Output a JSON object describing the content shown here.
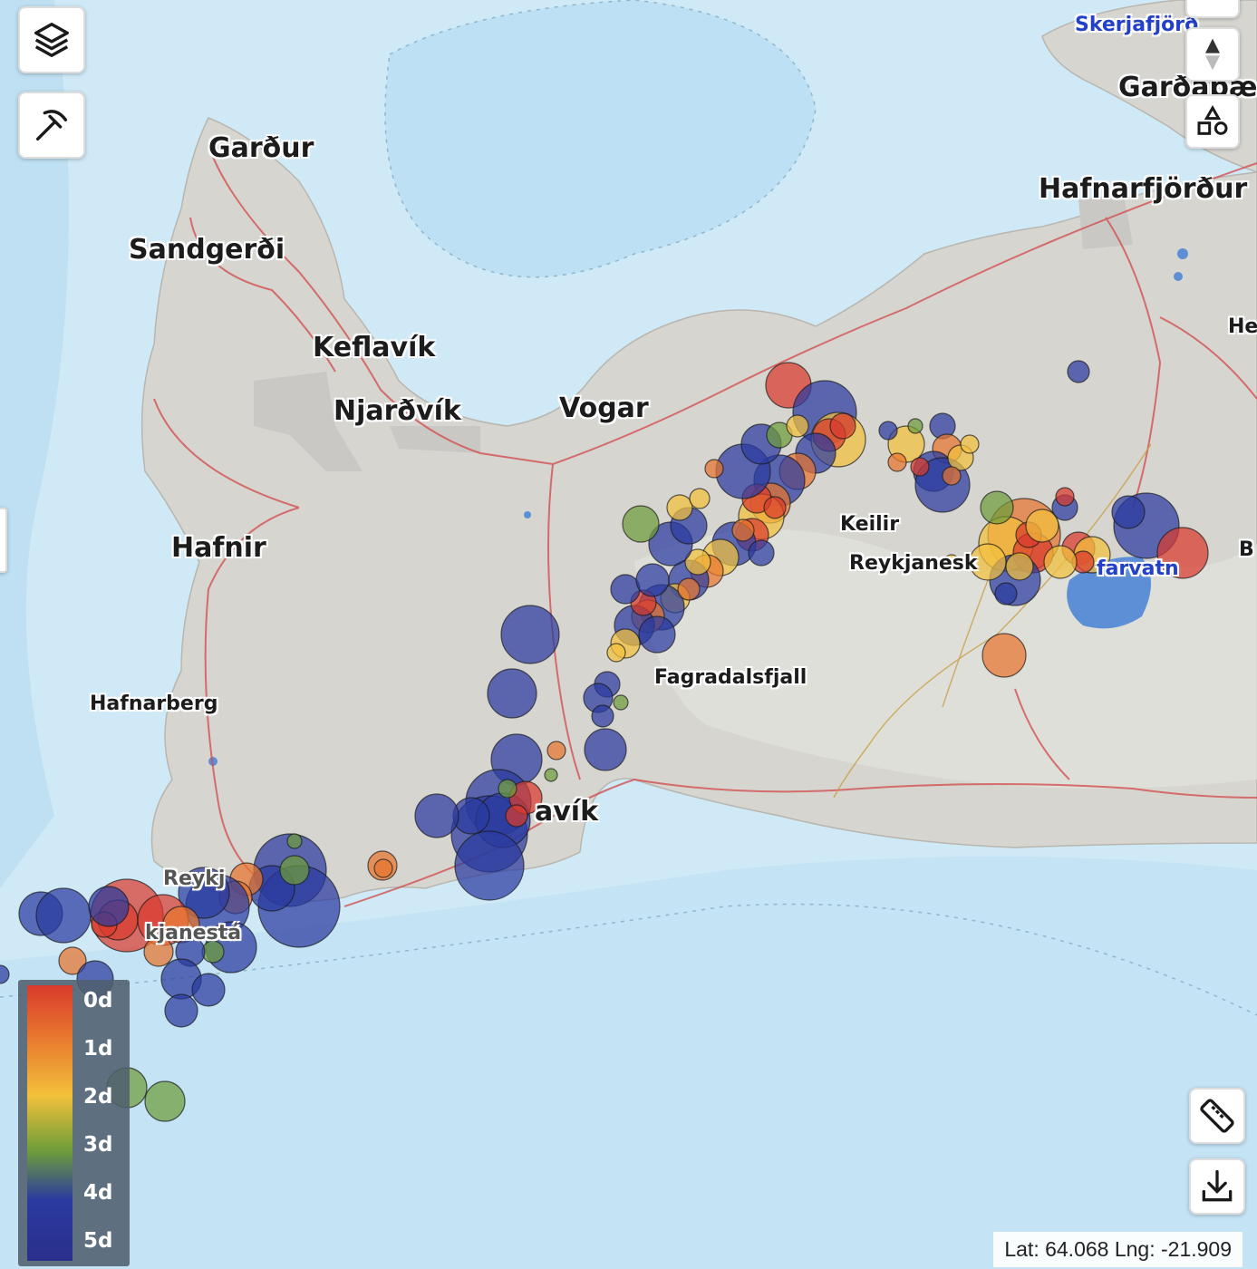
{
  "map": {
    "places": [
      {
        "name": "Garður"
      },
      {
        "name": "Sandgerði"
      },
      {
        "name": "Keflavík"
      },
      {
        "name": "Njarðvík"
      },
      {
        "name": "Vogar"
      },
      {
        "name": "Hafnir"
      },
      {
        "name": "Hafnarberg"
      },
      {
        "name": "Keilir"
      },
      {
        "name": "Reykjanesk"
      },
      {
        "name": "Fagradalsfjall"
      },
      {
        "name": "avík"
      },
      {
        "name": "Hafnarfjörður"
      },
      {
        "name": "Garðabær"
      },
      {
        "name": "Skerjafjörð"
      },
      {
        "name": "Reykj"
      },
      {
        "name": "kjanestá"
      },
      {
        "name": "farvatn"
      },
      {
        "name": "He"
      },
      {
        "name": "B"
      }
    ],
    "earthquake_color_scale": [
      "#d93a2c",
      "#e8742e",
      "#f3c13b",
      "#6e9d3a",
      "#2a3aa0"
    ]
  },
  "legend": {
    "ticks": [
      "0d",
      "1d",
      "2d",
      "3d",
      "4d",
      "5d"
    ]
  },
  "status": {
    "coordinates": "Lat: 64.068 Lng: -21.909"
  },
  "controls": {
    "layers": "layers-icon",
    "tools": "pickaxe-icon",
    "compass": "compass-icon",
    "shapes": "shapes-icon",
    "measure": "ruler-icon",
    "download": "download-icon"
  }
}
